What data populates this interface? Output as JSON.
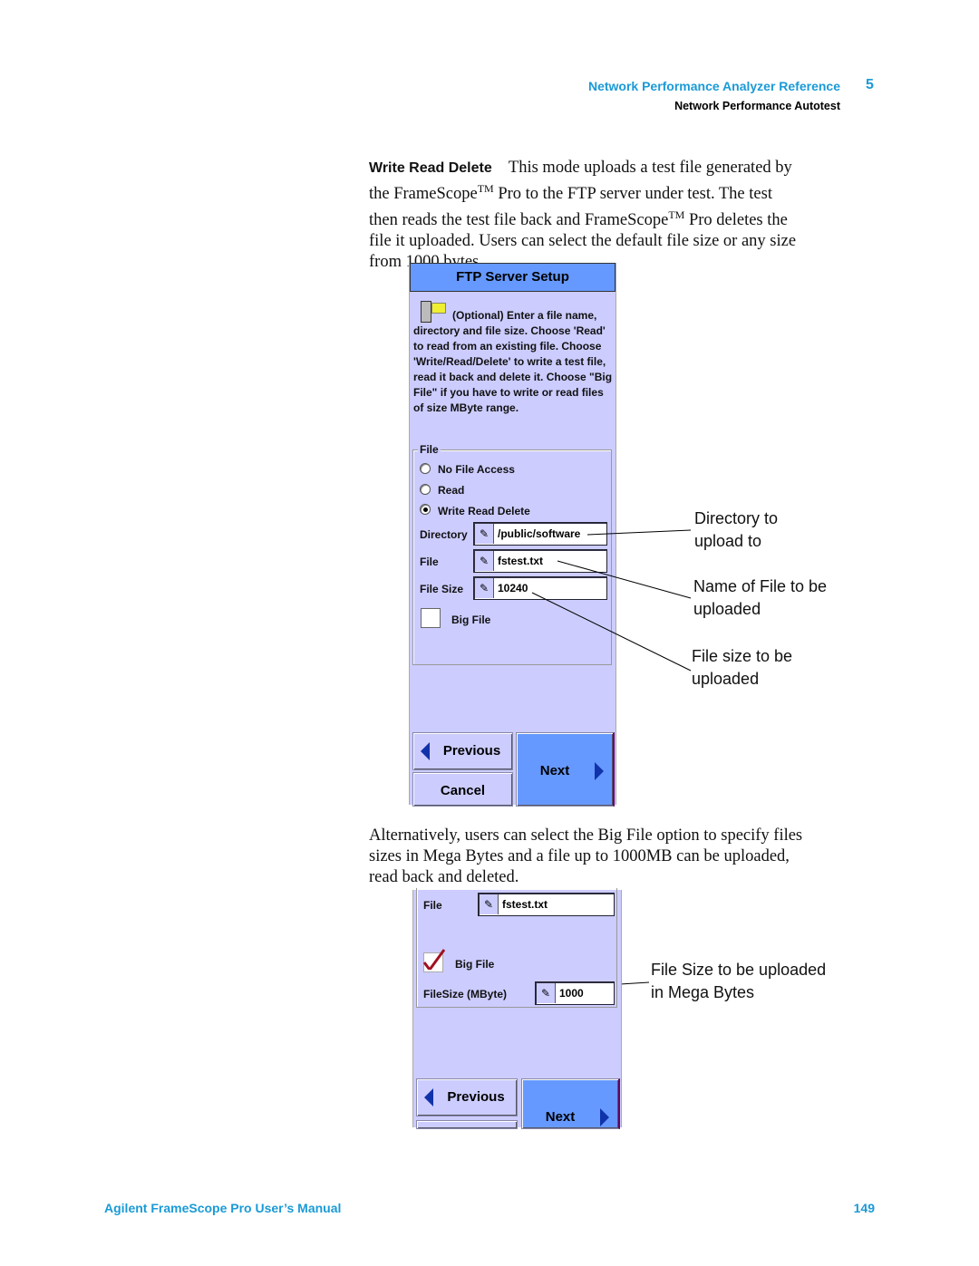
{
  "header": {
    "chapter_title": "Network Performance Analyzer Reference",
    "chapter_number": "5",
    "section_title": "Network Performance Autotest"
  },
  "intro": {
    "term": "Write Read Delete",
    "line1": "This mode uploads a test file generated by",
    "line2a": "the FrameScope",
    "tm": "TM",
    "line2b": " Pro to the FTP server under test. The test",
    "line3a": "then reads the test file back and FrameScope",
    "line3b": " Pro deletes the",
    "line4": "file it uploaded.  Users can select the default file size or any size",
    "line5": "from 1000 bytes."
  },
  "screen1": {
    "title": "FTP Server Setup",
    "icon": "ftp-server-folder-icon",
    "description": "(Optional) Enter a file name, directory and file size.  Choose 'Read' to read from an existing file. Choose 'Write/Read/Delete' to write a test file, read it back and delete it. Choose \"Big File\" if you have to write or read files of size MByte range.",
    "group_label": "File",
    "radios": [
      {
        "label": "No File Access",
        "selected": false
      },
      {
        "label": "Read",
        "selected": false
      },
      {
        "label": "Write Read Delete",
        "selected": true
      }
    ],
    "fields": [
      {
        "label": "Directory",
        "value": "/public/software"
      },
      {
        "label": "File",
        "value": "fstest.txt"
      },
      {
        "label": "File Size",
        "value": "10240"
      }
    ],
    "big_file": {
      "label": "Big File",
      "checked": false
    },
    "buttons": {
      "previous": "Previous",
      "cancel": "Cancel",
      "next": "Next"
    }
  },
  "callouts1": {
    "directory": [
      "Directory to",
      "upload to"
    ],
    "file": [
      "Name of File to be",
      "uploaded"
    ],
    "size": [
      "File size to be",
      "uploaded"
    ]
  },
  "middle": {
    "line1": "Alternatively, users can select the Big File option to specify files",
    "line2": "sizes in Mega Bytes and a file up to 1000MB can be uploaded,",
    "line3": "read back and deleted."
  },
  "screen2": {
    "file_label": "File",
    "file_value": "fstest.txt",
    "big_file": {
      "label": "Big File",
      "checked": true
    },
    "size_label": "FileSize (MByte)",
    "size_value": "1000",
    "buttons": {
      "previous": "Previous",
      "next": "Next"
    }
  },
  "callouts2": {
    "size": [
      "File Size to be uploaded",
      "in Mega Bytes"
    ]
  },
  "footer": {
    "manual_title": "Agilent FrameScope Pro User’s Manual",
    "page_number": "149"
  },
  "colors": {
    "accent": "#1a9ad6",
    "panel": "#ccccff",
    "title_bar": "#6699ff"
  }
}
